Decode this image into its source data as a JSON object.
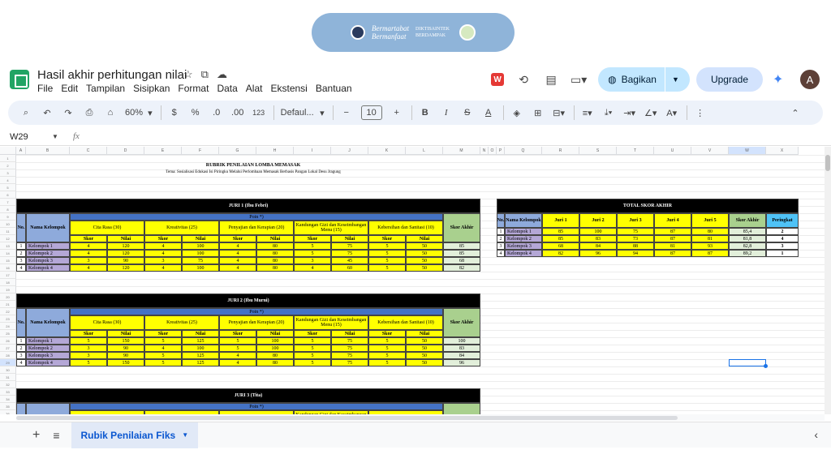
{
  "banner": {
    "line1": "Bermartabat",
    "line2": "Bermanfaat",
    "line3": "DIKTISAINTEK BERDAMPAK"
  },
  "doc": {
    "title": "Hasil akhir perhitungan nilai"
  },
  "menus": [
    "File",
    "Edit",
    "Tampilan",
    "Sisipkan",
    "Format",
    "Data",
    "Alat",
    "Ekstensi",
    "Bantuan"
  ],
  "actions": {
    "share": "Bagikan",
    "upgrade": "Upgrade",
    "avatar": "A"
  },
  "toolbar": {
    "zoom": "60%",
    "currency": "$",
    "percent": "%",
    "dec_dec": ".0",
    "dec_inc": ".00",
    "numfmt": "123",
    "font": "Defaul...",
    "size": "10",
    "bold": "B",
    "italic": "I",
    "strike": "S",
    "textcolor": "A"
  },
  "formula": {
    "cell": "W29",
    "fx": "fx"
  },
  "columns": [
    "A",
    "B",
    "C",
    "D",
    "E",
    "F",
    "G",
    "H",
    "I",
    "J",
    "K",
    "L",
    "M",
    "N",
    "O",
    "P",
    "Q",
    "R",
    "S",
    "T",
    "U",
    "V",
    "W",
    "X"
  ],
  "sheet": {
    "title": "RUBRIK PENILAIAN LOMBA MEMASAK",
    "subtitle": "Tema: Sosialisasi Edukasi Isi Piringku Melalui Perlombaan Memasak Berbasis Pangan Lokal Desu Jragung",
    "juri1": "JURI 1 (Ibu Febri)",
    "juri2": "JURI 2 (Ibu Murni)",
    "juri3": "JURI 3 (Tita)",
    "poin": "Poin *)",
    "no": "No.",
    "nama": "Nama Kelompok",
    "crit": [
      "Cita Rasa (30)",
      "Kreativitas (25)",
      "Penyajian dan Kerapian (20)",
      "Kandungan Gizi dan Keseimbangan Menu (15)",
      "Kebersihan dan Sanitasi (10)"
    ],
    "skor": "Skor",
    "nilai": "Nilai",
    "skor_akhir": "Skor Akhir",
    "groups": [
      "Kelompok 1",
      "Kelompok 2",
      "Kelompok 3",
      "Kelompok 4"
    ],
    "j1": [
      [
        "4",
        "120",
        "4",
        "100",
        "4",
        "80",
        "5",
        "75",
        "5",
        "50",
        "85"
      ],
      [
        "4",
        "120",
        "4",
        "100",
        "4",
        "80",
        "5",
        "75",
        "5",
        "50",
        "85"
      ],
      [
        "3",
        "90",
        "3",
        "75",
        "4",
        "80",
        "3",
        "45",
        "5",
        "50",
        "68"
      ],
      [
        "4",
        "120",
        "4",
        "100",
        "4",
        "80",
        "4",
        "60",
        "5",
        "50",
        "82"
      ]
    ],
    "j2": [
      [
        "5",
        "150",
        "5",
        "125",
        "5",
        "100",
        "5",
        "75",
        "5",
        "50",
        "100"
      ],
      [
        "3",
        "90",
        "4",
        "100",
        "5",
        "100",
        "5",
        "75",
        "5",
        "50",
        "83"
      ],
      [
        "3",
        "90",
        "5",
        "125",
        "4",
        "80",
        "5",
        "75",
        "5",
        "50",
        "84"
      ],
      [
        "5",
        "150",
        "5",
        "125",
        "4",
        "80",
        "5",
        "75",
        "5",
        "50",
        "96"
      ]
    ],
    "total": {
      "title": "TOTAL SKOR AKHIR",
      "heads": [
        "No.",
        "Nama Kelompok",
        "Juri 1",
        "Juri 2",
        "Juri 3",
        "Juri 4",
        "Juri 5",
        "Skor Akhir",
        "Peringkat"
      ],
      "rows": [
        [
          "1",
          "Kelompok 1",
          "85",
          "100",
          "75",
          "87",
          "80",
          "85,4",
          "2"
        ],
        [
          "2",
          "Kelompok 2",
          "85",
          "83",
          "73",
          "87",
          "81",
          "81,8",
          "4"
        ],
        [
          "3",
          "Kelompok 3",
          "68",
          "84",
          "88",
          "81",
          "93",
          "82,8",
          "3"
        ],
        [
          "4",
          "Kelompok 4",
          "82",
          "96",
          "94",
          "87",
          "87",
          "89,2",
          "1"
        ]
      ]
    }
  },
  "tabs": {
    "active": "Rubik Penilaian Fiks"
  },
  "colors": {
    "black": "#000000",
    "blue": "#4472c4",
    "yellow": "#ffff00",
    "purple": "#b4a7d6",
    "green": "#a9d08e"
  }
}
